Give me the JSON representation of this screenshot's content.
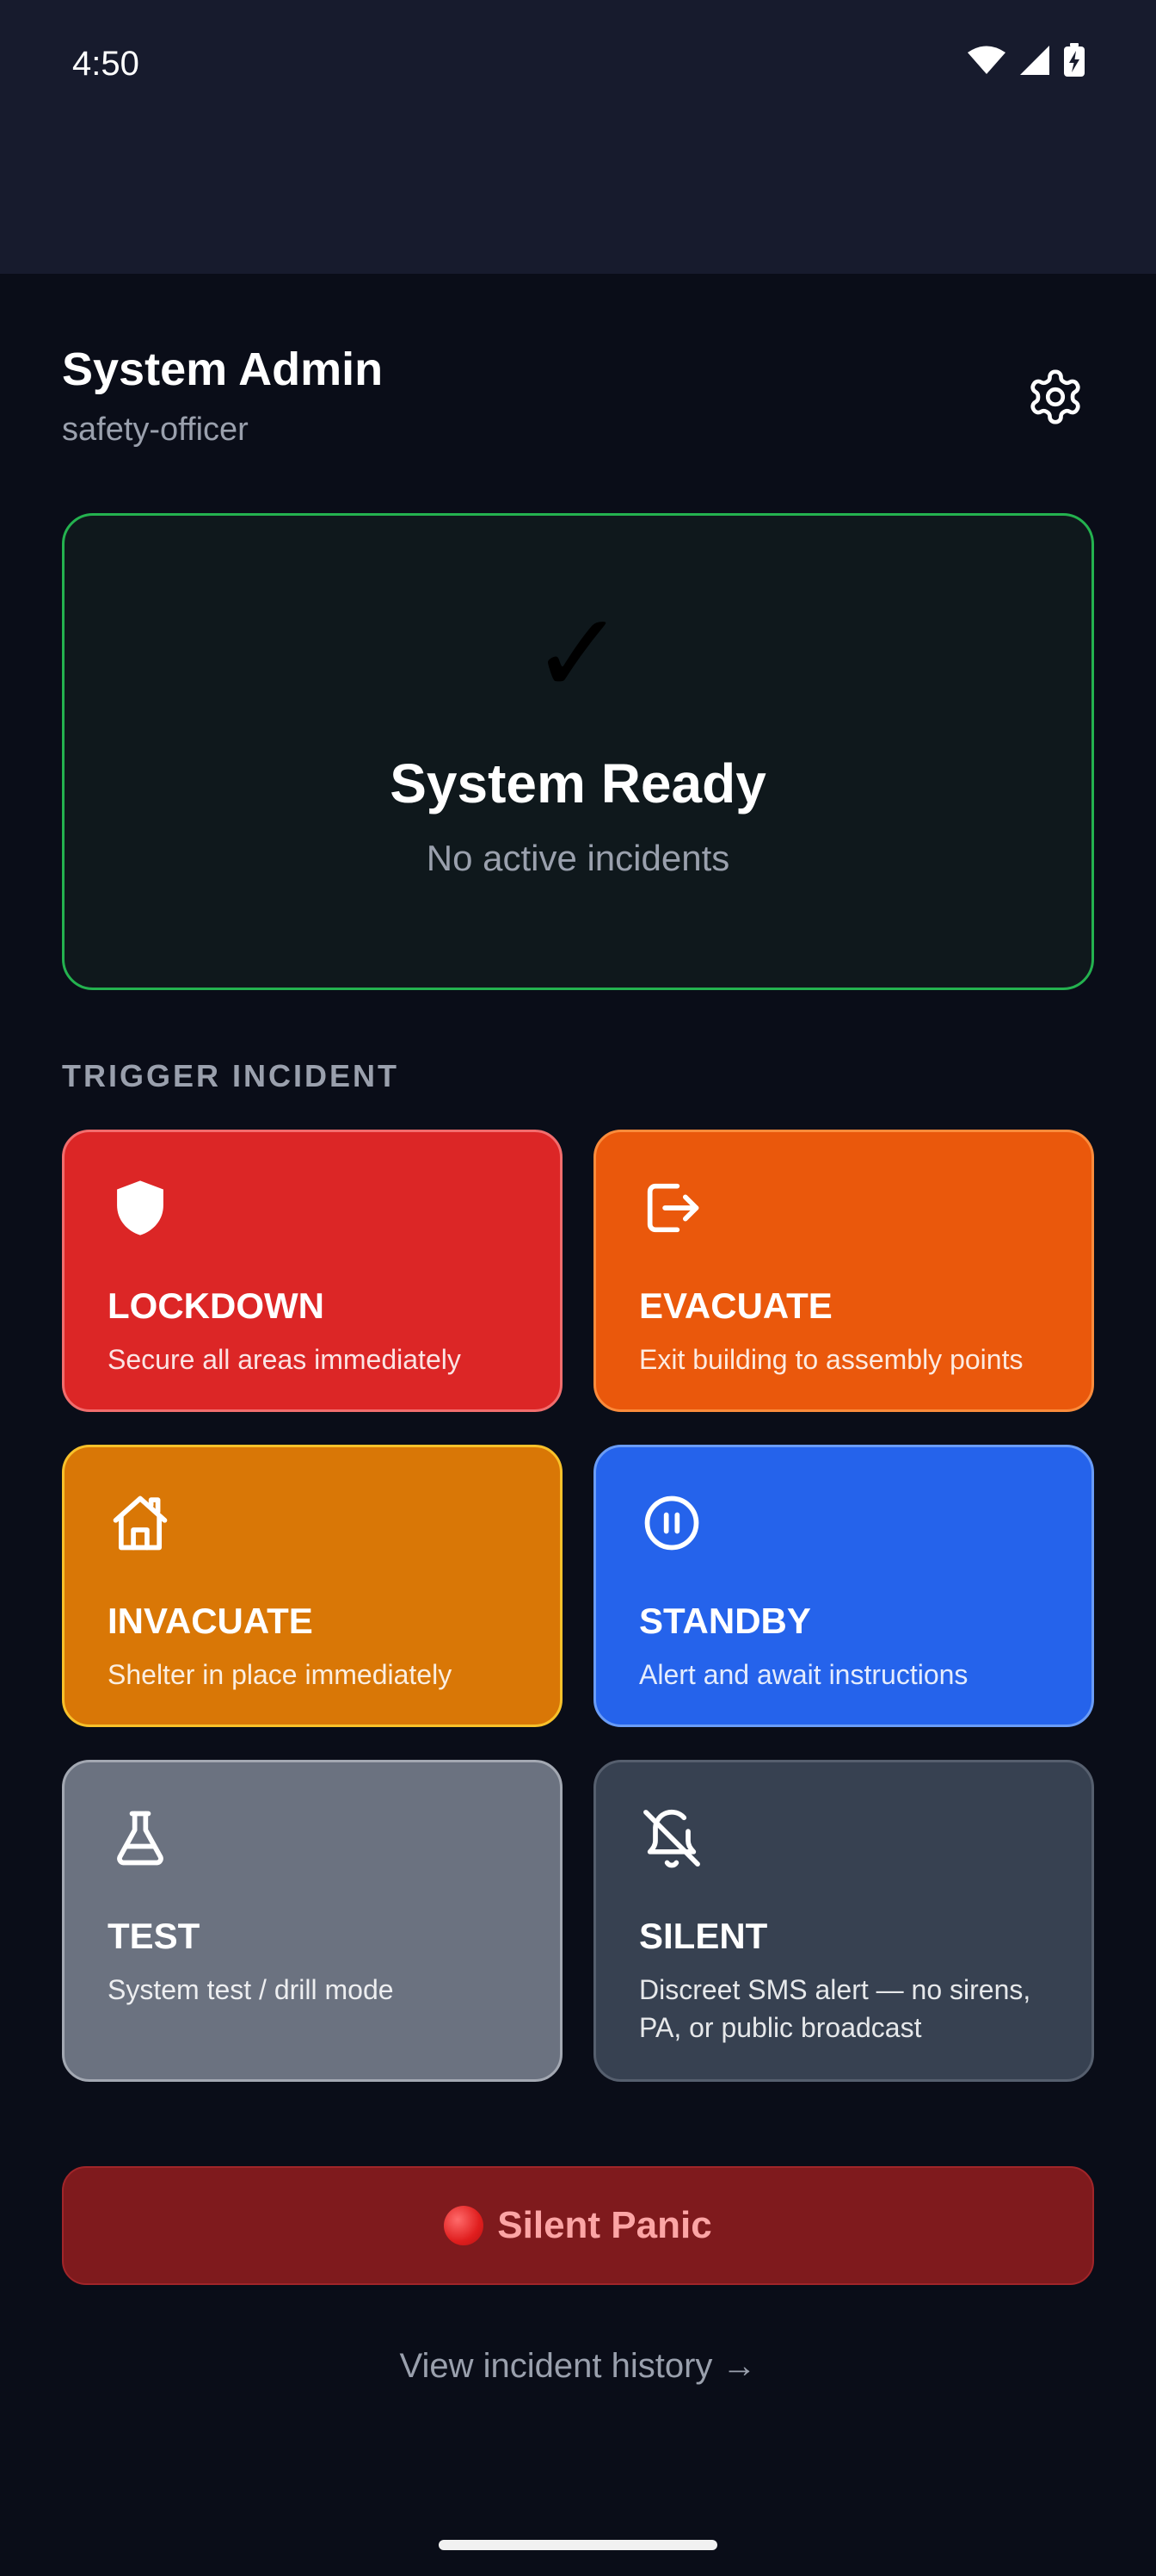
{
  "status_bar": {
    "time": "4:50",
    "icons": [
      "wifi-icon",
      "signal-icon",
      "battery-charging-icon"
    ]
  },
  "header": {
    "user_name": "System Admin",
    "user_role": "safety-officer",
    "settings_icon": "gear-icon"
  },
  "status_card": {
    "icon": "✓",
    "title": "System Ready",
    "subtitle": "No active incidents",
    "accent_color": "#24b24f"
  },
  "trigger_section": {
    "label": "TRIGGER INCIDENT",
    "incidents": [
      {
        "id": "lockdown",
        "label": "LOCKDOWN",
        "description": "Secure all areas immediately",
        "icon": "shield-icon",
        "color": "#dc2626"
      },
      {
        "id": "evacuate",
        "label": "EVACUATE",
        "description": "Exit building to assembly points",
        "icon": "exit-icon",
        "color": "#ea580c"
      },
      {
        "id": "invacuate",
        "label": "INVACUATE",
        "description": "Shelter in place immediately",
        "icon": "home-icon",
        "color": "#d97706"
      },
      {
        "id": "standby",
        "label": "STANDBY",
        "description": "Alert and await instructions",
        "icon": "pause-circle-icon",
        "color": "#2563eb"
      },
      {
        "id": "test",
        "label": "TEST",
        "description": "System test / drill mode",
        "icon": "flask-icon",
        "color": "#6b7280"
      },
      {
        "id": "silent",
        "label": "SILENT",
        "description": "Discreet SMS alert — no sirens, PA, or public broadcast",
        "icon": "bell-off-icon",
        "color": "#374151"
      }
    ]
  },
  "panic_button": {
    "label": "Silent Panic",
    "icon": "red-circle-icon",
    "color": "#7f1a1d"
  },
  "history_link": {
    "label": "View incident history →"
  }
}
